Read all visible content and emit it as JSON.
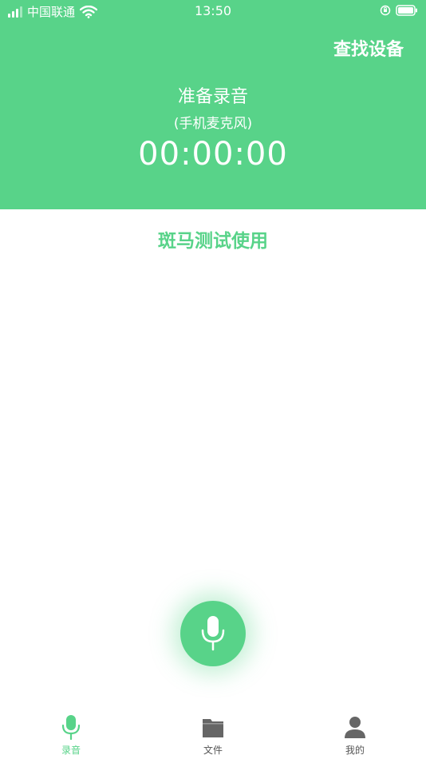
{
  "status_bar": {
    "carrier": "中国联通",
    "time": "13:50"
  },
  "header": {
    "find_device": "查找设备",
    "recording_status": "准备录音",
    "source": "(手机麦克风)",
    "timer": "00:00:00"
  },
  "main": {
    "label": "斑马测试使用"
  },
  "tabs": [
    {
      "label": "录音",
      "icon": "microphone-icon",
      "active": true
    },
    {
      "label": "文件",
      "icon": "folder-icon",
      "active": false
    },
    {
      "label": "我的",
      "icon": "person-icon",
      "active": false
    }
  ],
  "colors": {
    "accent": "#58d389",
    "tab_inactive": "#666666"
  }
}
